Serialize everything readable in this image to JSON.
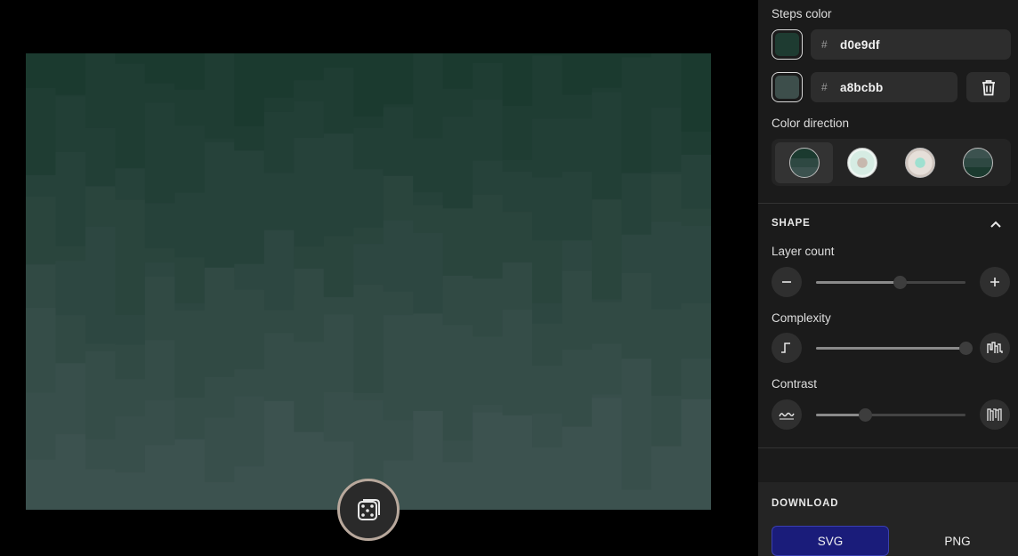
{
  "sidebar": {
    "steps_color": {
      "label": "Steps color",
      "hash": "#",
      "colors": [
        {
          "hex": "d0e9df",
          "swatch": "#1e3b31"
        },
        {
          "hex": "a8bcbb",
          "swatch": "#3d4e4b"
        }
      ]
    },
    "color_direction": {
      "label": "Color direction",
      "options": [
        {
          "name": "top-to-bottom",
          "active": true
        },
        {
          "name": "radial-light-center",
          "active": false
        },
        {
          "name": "radial-warm-center",
          "active": false
        },
        {
          "name": "bottom-to-top",
          "active": false
        }
      ]
    },
    "shape": {
      "header": "SHAPE",
      "layer_count": {
        "label": "Layer count",
        "value_fraction": 0.56
      },
      "complexity": {
        "label": "Complexity",
        "value_fraction": 1.0
      },
      "contrast": {
        "label": "Contrast",
        "value_fraction": 0.33
      }
    },
    "download": {
      "header": "DOWNLOAD",
      "svg_label": "SVG",
      "png_label": "PNG"
    }
  },
  "colors": {
    "top": "#1b3a2f",
    "bottom": "#3c524f",
    "accent": "#1a1c7a"
  }
}
